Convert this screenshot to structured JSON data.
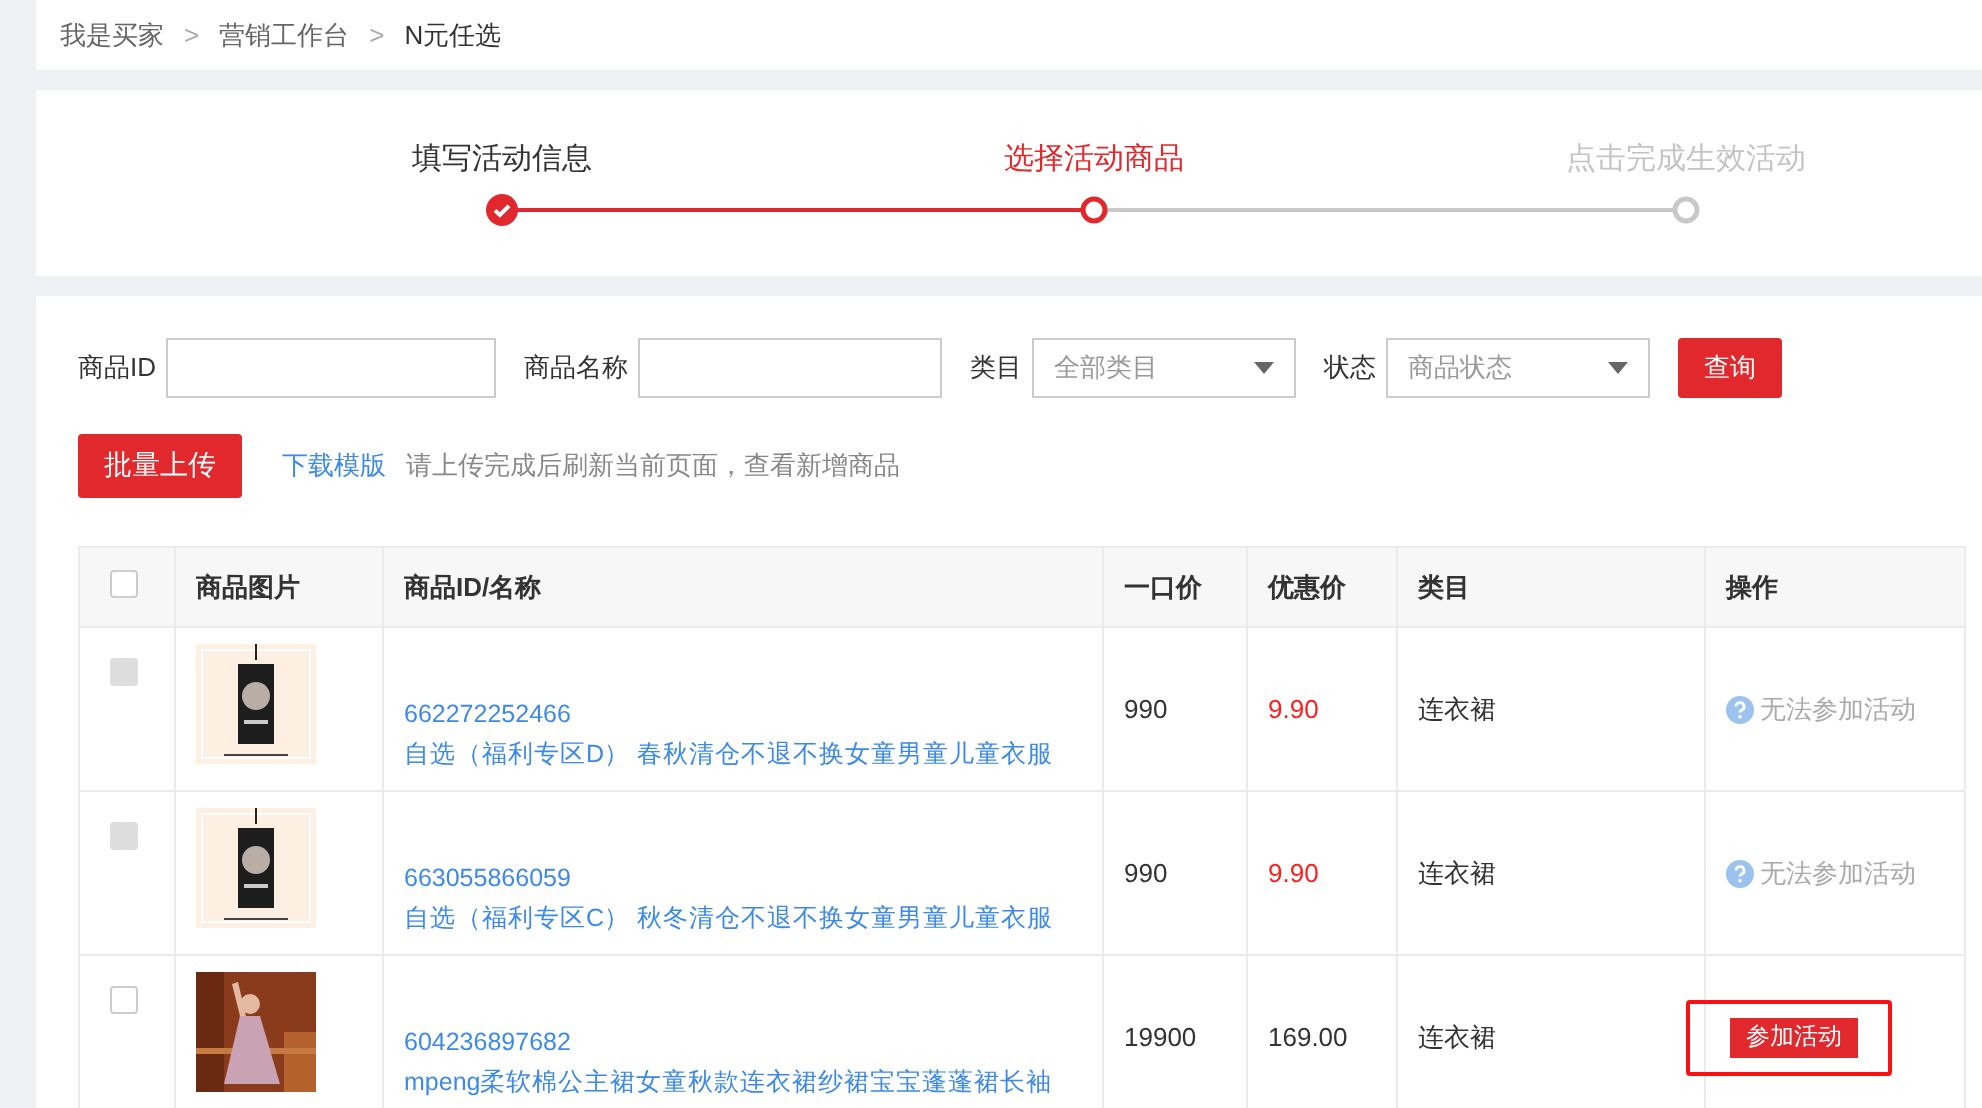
{
  "breadcrumb": [
    "我是买家",
    "营销工作台",
    "N元任选"
  ],
  "breadcrumb_separator": ">",
  "steps": [
    {
      "label": "填写活动信息",
      "completed": true,
      "active": false
    },
    {
      "label": "选择活动商品",
      "completed": false,
      "active": true
    },
    {
      "label": "点击完成生效活动",
      "completed": false,
      "active": false
    }
  ],
  "filters": [
    {
      "kind": "text",
      "label": "商品ID"
    },
    {
      "kind": "text",
      "label": "商品名称"
    },
    {
      "kind": "select",
      "label": "类目",
      "placeholder": "全部类目"
    },
    {
      "kind": "select",
      "label": "状态",
      "placeholder": "商品状态"
    }
  ],
  "search_button": "查询",
  "upload_button": "批量上传",
  "template_link": "下载模版",
  "upload_hint": "请上传完成后刷新当前页面，查看新增商品",
  "table": {
    "select_all_checked": false,
    "columns": [
      "商品图片",
      "商品ID/名称",
      "一口价",
      "优惠价",
      "类目",
      "操作"
    ],
    "rows": [
      {
        "checkbox_disabled": true,
        "id": "662272252466",
        "name": "自选（福利专区D） 春秋清仓不退不换女童男童儿童衣服",
        "price": "990",
        "sale_price": "9.90",
        "sale_price_alert": true,
        "category": "连衣裙",
        "action": {
          "kind": "unavailable",
          "label": "无法参加活动",
          "highlighted": false
        }
      },
      {
        "checkbox_disabled": true,
        "id": "663055866059",
        "name": "自选（福利专区C） 秋冬清仓不退不换女童男童儿童衣服",
        "price": "990",
        "sale_price": "9.90",
        "sale_price_alert": true,
        "category": "连衣裙",
        "action": {
          "kind": "unavailable",
          "label": "无法参加活动",
          "highlighted": false
        }
      },
      {
        "checkbox_disabled": false,
        "id": "604236897682",
        "name": "mpeng柔软棉公主裙女童秋款连衣裙纱裙宝宝蓬蓬裙长袖",
        "price": "19900",
        "sale_price": "169.00",
        "sale_price_alert": false,
        "category": "连衣裙",
        "action": {
          "kind": "button",
          "label": "参加活动",
          "highlighted": true
        }
      }
    ]
  }
}
